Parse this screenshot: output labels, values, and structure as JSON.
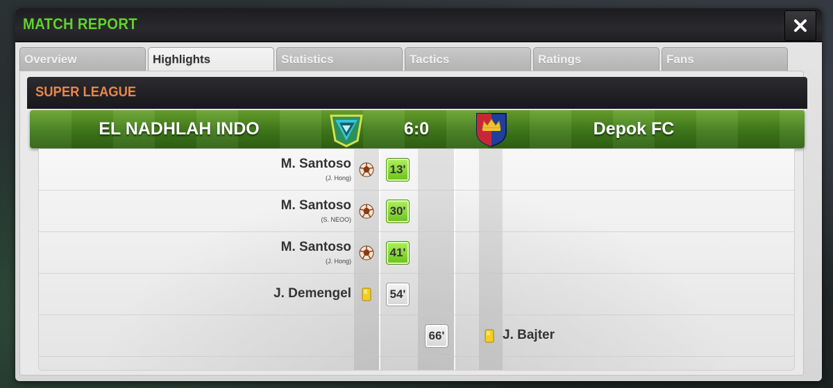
{
  "window": {
    "title": "MATCH REPORT"
  },
  "tabs": [
    {
      "label": "Overview"
    },
    {
      "label": "Highlights"
    },
    {
      "label": "Statistics"
    },
    {
      "label": "Tactics"
    },
    {
      "label": "Ratings"
    },
    {
      "label": "Fans"
    }
  ],
  "active_tab": "Highlights",
  "league": {
    "name": "SUPER LEAGUE"
  },
  "match": {
    "home_team": "EL NADHLAH INDO",
    "away_team": "Depok FC",
    "score": "6:0"
  },
  "events": [
    {
      "side": "home",
      "type": "goal",
      "player": "M. Santoso",
      "assist": "(J. Hong)",
      "minute": "13'",
      "icon": "soccer-ball-icon"
    },
    {
      "side": "home",
      "type": "goal",
      "player": "M. Santoso",
      "assist": "(S. NEOO)",
      "minute": "30'",
      "icon": "soccer-ball-icon"
    },
    {
      "side": "home",
      "type": "goal",
      "player": "M. Santoso",
      "assist": "(J. Hong)",
      "minute": "41'",
      "icon": "soccer-ball-icon"
    },
    {
      "side": "home",
      "type": "yellow-card",
      "player": "J. Demengel",
      "assist": "",
      "minute": "54'",
      "icon": "yellow-card-icon"
    },
    {
      "side": "away",
      "type": "yellow-card",
      "player": "J. Bajter",
      "assist": "",
      "minute": "66'",
      "icon": "yellow-card-icon"
    }
  ],
  "colors": {
    "title_green": "#5fd12e",
    "league_orange": "#e8864a",
    "goal_badge_green": "#8fdc3c",
    "yellow_card": "#f2cf22",
    "away_crest_red": "#c8273a",
    "away_crest_blue": "#1f3fa0"
  }
}
